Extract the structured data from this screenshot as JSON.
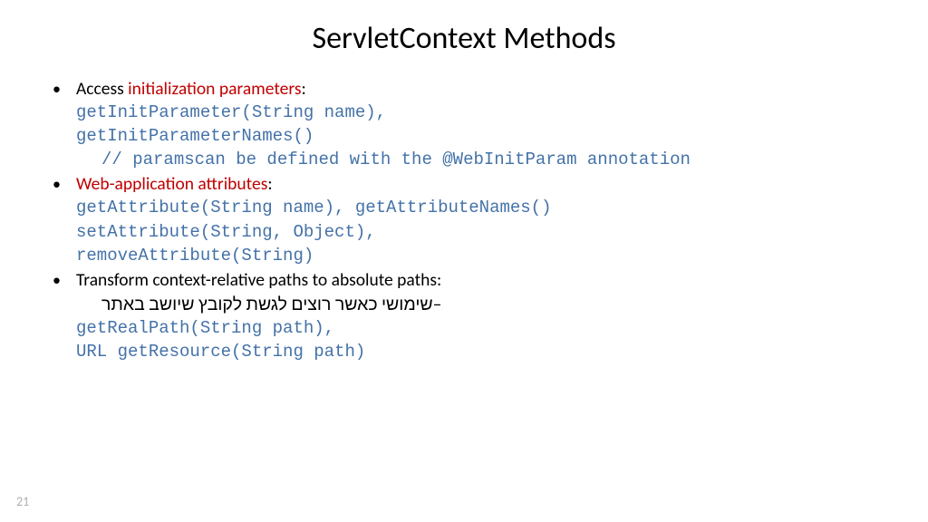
{
  "title": "ServletContext Methods",
  "b1_prefix": "Access ",
  "b1_red": "initialization parameters",
  "b1_suffix": ":",
  "code1a": "getInitParameter(String name),",
  "code1b": "getInitParameterNames()",
  "code1c": "// paramscan be defined with the @WebInitParam annotation",
  "b2_red": "Web-application attributes",
  "b2_suffix": ":",
  "code2a": "getAttribute(String name), getAttributeNames()",
  "code2b": "setAttribute(String, Object),",
  "code2c": "removeAttribute(String)",
  "b3_text": "Transform context-relative paths to absolute paths:",
  "sub3_dash": "–",
  "sub3_text": "שימושי כאשר רוצים לגשת לקובץ שיושב באתר",
  "code3a": "getRealPath(String path),",
  "code3b": "URL getResource(String path)",
  "page_num": "21"
}
